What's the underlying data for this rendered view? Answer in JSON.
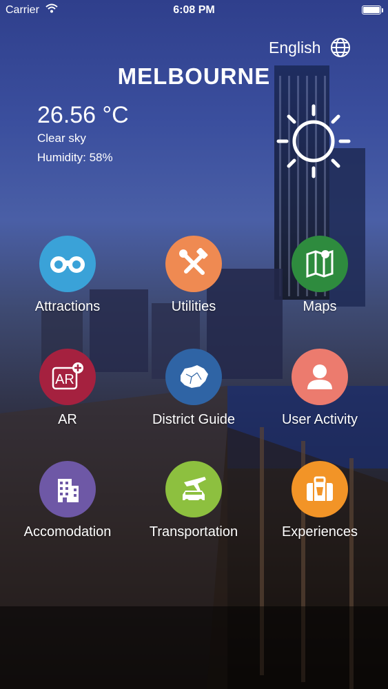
{
  "status_bar": {
    "carrier": "Carrier",
    "time": "6:08 PM"
  },
  "header": {
    "language": "English",
    "city": "MELBOURNE"
  },
  "weather": {
    "temperature": "26.56 °C",
    "condition": "Clear sky",
    "humidity": "Humidity: 58%",
    "icon": "sun-icon"
  },
  "menu": [
    {
      "label": "Attractions",
      "icon": "binoculars-icon",
      "color": "#3aa2d8"
    },
    {
      "label": "Utilities",
      "icon": "tools-icon",
      "color": "#ef8a52"
    },
    {
      "label": "Maps",
      "icon": "map-icon",
      "color": "#2e8b3e"
    },
    {
      "label": "AR",
      "icon": "ar-icon",
      "color": "#a5213f"
    },
    {
      "label": "District Guide",
      "icon": "district-map-icon",
      "color": "#2f64a5"
    },
    {
      "label": "User Activity",
      "icon": "user-icon",
      "color": "#ec7b6e"
    },
    {
      "label": "Accomodation",
      "icon": "building-icon",
      "color": "#6e58a6"
    },
    {
      "label": "Transportation",
      "icon": "transport-icon",
      "color": "#8dc03f"
    },
    {
      "label": "Experiences",
      "icon": "suitcase-icon",
      "color": "#f29427"
    }
  ]
}
